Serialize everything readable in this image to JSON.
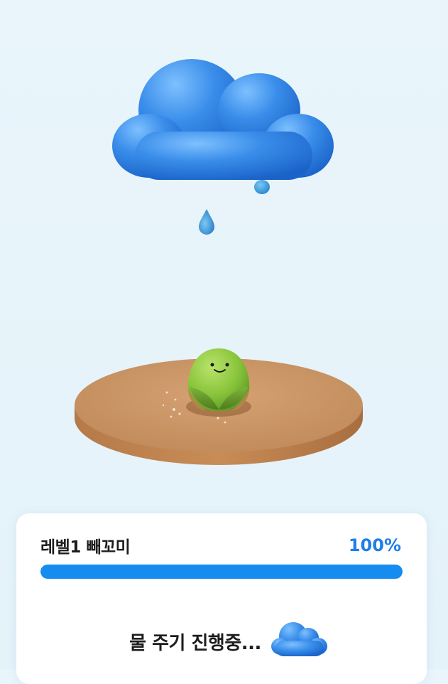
{
  "scene": {
    "cloud_icon": "rain-cloud-icon",
    "droplet_icon": "water-drop-icon",
    "plant_icon": "sprout-bean-icon",
    "soil_icon": "soil-disc-icon",
    "colors": {
      "cloud": "#2f86e6",
      "drop": "#2b8fd6",
      "sprout": "#8cc63f",
      "soil": "#c89262",
      "background": "#e6f3fa"
    }
  },
  "status_card": {
    "level_label": "레벨1 빼꼬미",
    "progress_text": "100%",
    "progress_value": 1.0,
    "progress_color": "#168cf0",
    "status_text": "물 주기 진행중...",
    "status_icon": "cloud-icon"
  }
}
